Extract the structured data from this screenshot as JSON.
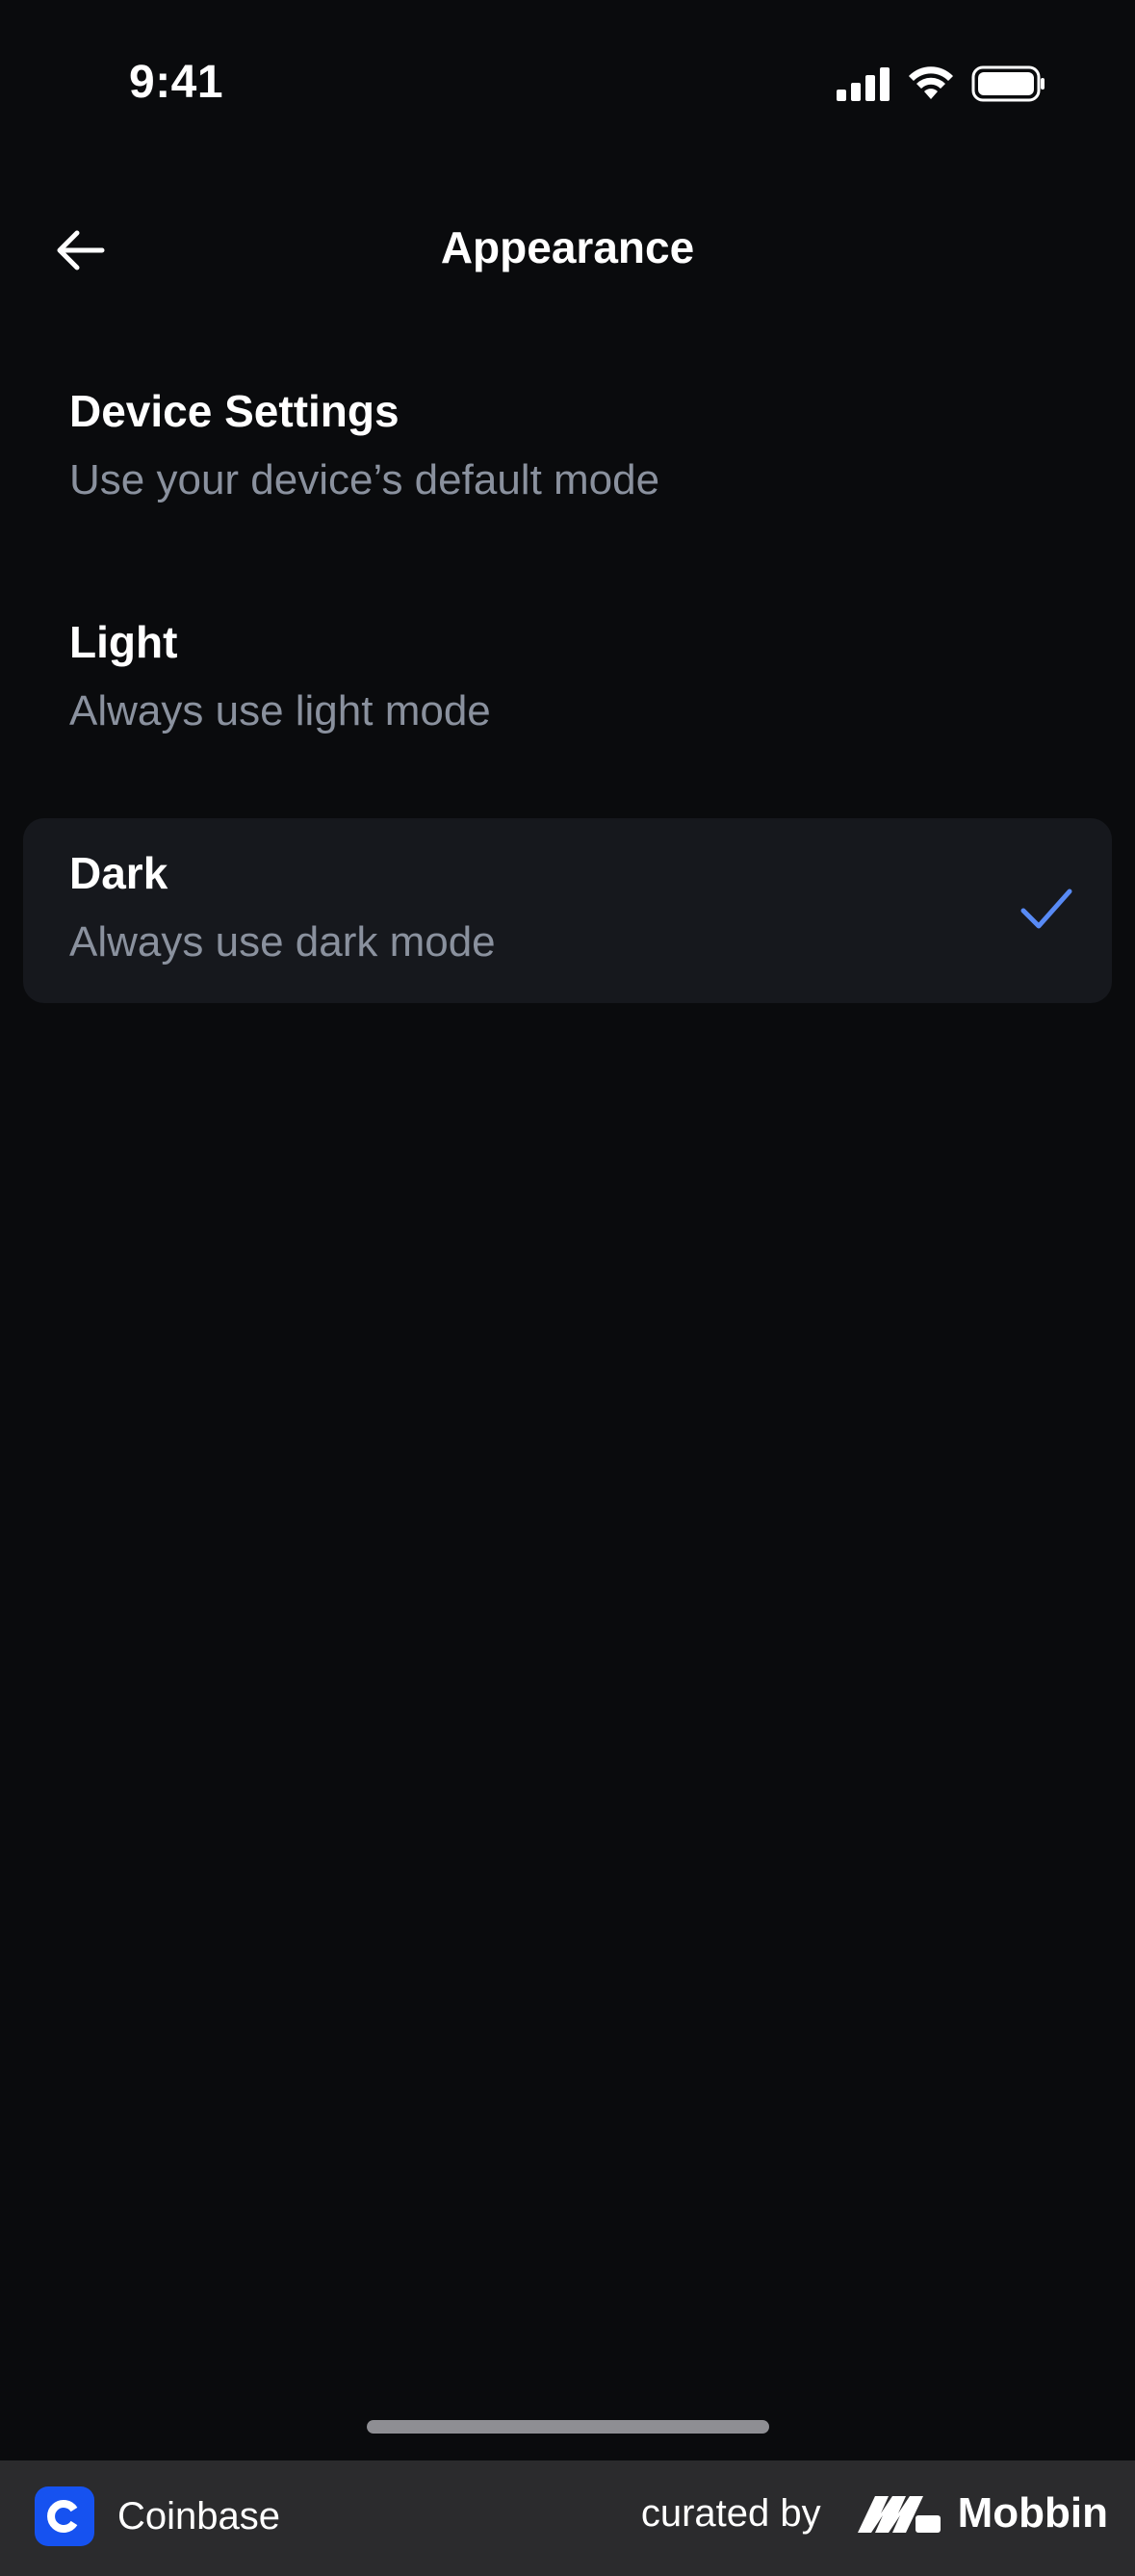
{
  "status_bar": {
    "time": "9:41"
  },
  "nav": {
    "title": "Appearance",
    "back_icon": "arrow-left-icon"
  },
  "options": [
    {
      "title": "Device Settings",
      "subtitle": "Use your device’s default mode",
      "selected": false
    },
    {
      "title": "Light",
      "subtitle": "Always use light mode",
      "selected": false
    },
    {
      "title": "Dark",
      "subtitle": "Always use dark mode",
      "selected": true
    }
  ],
  "colors": {
    "background": "#0a0b0d",
    "selected_row": "#16181d",
    "check_accent": "#588af5",
    "subtitle": "#8a919e",
    "coinbase_brand": "#1652f0"
  },
  "footer": {
    "app_name": "Coinbase",
    "curated_by": "curated by",
    "brand": "Mobbin"
  }
}
